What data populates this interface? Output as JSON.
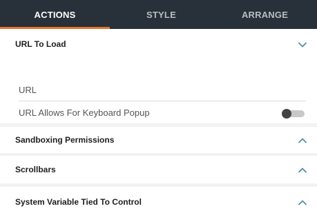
{
  "tabs": [
    {
      "label": "ACTIONS",
      "active": true
    },
    {
      "label": "STYLE",
      "active": false
    },
    {
      "label": "ARRANGE",
      "active": false
    }
  ],
  "colors": {
    "tab_bar_bg": "#283139",
    "active_underline": "#e8732a",
    "chevron": "#4a90a4"
  },
  "sections": {
    "url_to_load": {
      "title": "URL To Load",
      "expanded": true,
      "chevron": "chevron-down-icon",
      "url_field_label": "URL",
      "keyboard_popup_label": "URL Allows For Keyboard Popup",
      "keyboard_popup_enabled": false
    },
    "sandboxing": {
      "title": "Sandboxing Permissions",
      "chevron": "chevron-up-icon"
    },
    "scrollbars": {
      "title": "Scrollbars",
      "chevron": "chevron-up-icon"
    },
    "system_variable": {
      "title": "System Variable Tied To Control",
      "chevron": "chevron-up-icon"
    }
  }
}
